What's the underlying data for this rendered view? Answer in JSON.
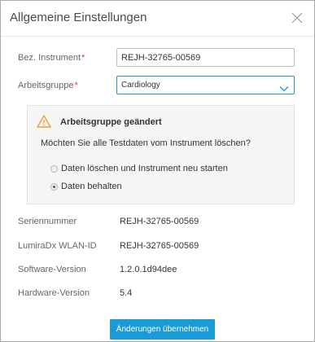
{
  "dialog": {
    "title": "Allgemeine Einstellungen"
  },
  "form": {
    "instrument_label": "Bez. Instrument",
    "required_mark": "*",
    "instrument_value": "REJH-32765-00569",
    "workgroup_label": "Arbeitsgruppe",
    "workgroup_value": "Cardiology"
  },
  "alert": {
    "title": "Arbeitsgruppe geändert",
    "question": "Möchten Sie alle Testdaten vom Instrument löschen?",
    "options": [
      {
        "label": "Daten löschen und Instrument neu starten",
        "checked": false
      },
      {
        "label": "Daten behalten",
        "checked": true
      }
    ],
    "icon_color": "#e8a23a"
  },
  "info": [
    {
      "label": "Seriennummer",
      "value": "REJH-32765-00569"
    },
    {
      "label": "LumiraDx WLAN-ID",
      "value": "REJH-32765-00569"
    },
    {
      "label": "Software-Version",
      "value": "1.2.0.1d94dee"
    },
    {
      "label": "Hardware-Version",
      "value": "5.4"
    }
  ],
  "footer": {
    "apply_label": "Änderungen übernehmen"
  },
  "colors": {
    "accent": "#1a9bd7",
    "required": "#e04040"
  }
}
